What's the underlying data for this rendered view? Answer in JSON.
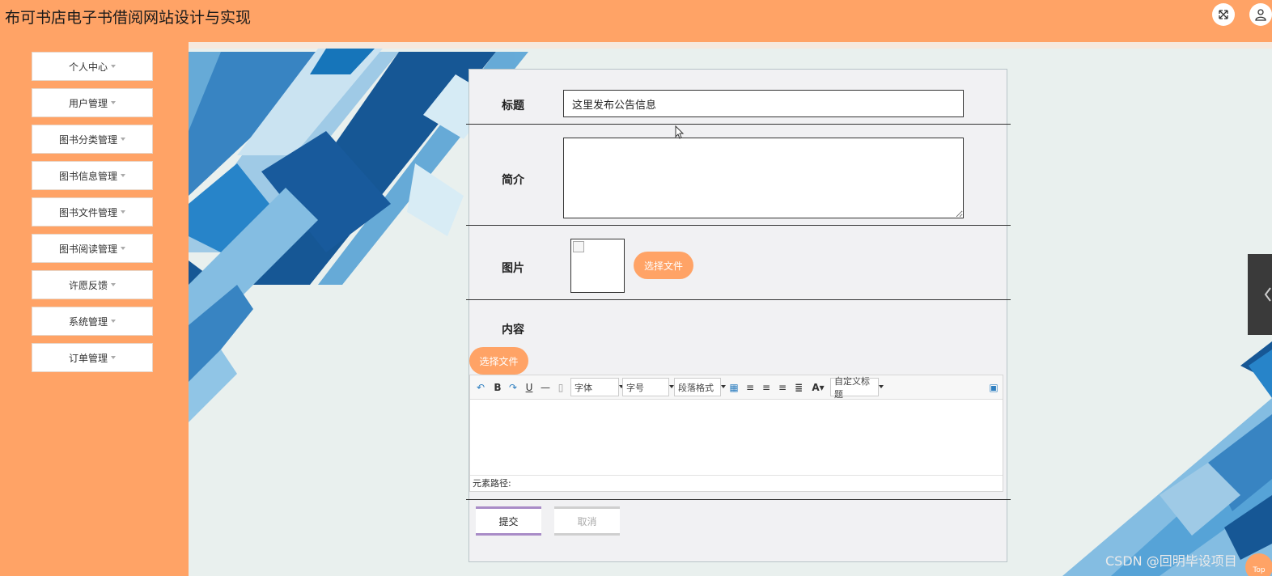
{
  "app": {
    "title": "布可书店电子书借阅网站设计与实现"
  },
  "header_icons": [
    "fullscreen-icon",
    "user-icon"
  ],
  "sidebar": {
    "items": [
      {
        "label": "个人中心"
      },
      {
        "label": "用户管理"
      },
      {
        "label": "图书分类管理"
      },
      {
        "label": "图书信息管理"
      },
      {
        "label": "图书文件管理"
      },
      {
        "label": "图书阅读管理"
      },
      {
        "label": "许愿反馈"
      },
      {
        "label": "系统管理"
      },
      {
        "label": "订单管理"
      }
    ]
  },
  "form": {
    "title_label": "标题",
    "title_value": "这里发布公告信息",
    "intro_label": "简介",
    "intro_value": "",
    "image_label": "图片",
    "image_choose_label": "选择文件",
    "content_label": "内容",
    "content_choose_label": "选择文件",
    "submit_label": "提交",
    "cancel_label": "取消"
  },
  "editor": {
    "font_select": "字体",
    "size_select": "字号",
    "paragraph_select": "段落格式",
    "custom_title_select": "自定义标题",
    "status_path": "元素路径:"
  },
  "colors": {
    "accent": "#ffa366",
    "submit_border": "#a98cc7"
  },
  "watermark": "CSDN @回明毕设项目",
  "top_badge": "Top"
}
